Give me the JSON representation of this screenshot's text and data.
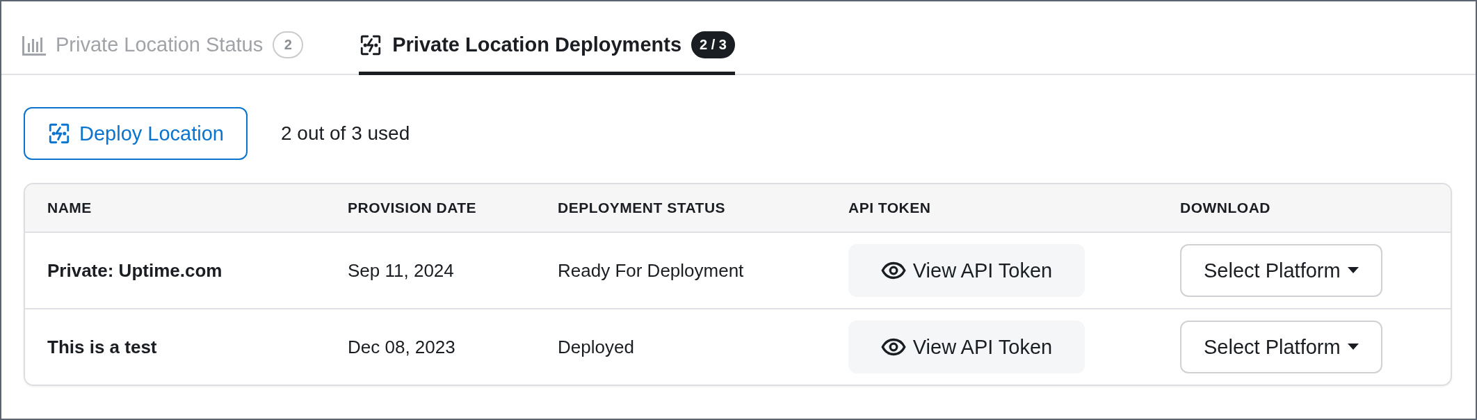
{
  "tabs": [
    {
      "label": "Private Location Status",
      "badge": "2",
      "kind": "chart",
      "selected": false
    },
    {
      "label": "Private Location Deployments",
      "badge": "2 / 3",
      "kind": "deploy",
      "selected": true
    }
  ],
  "deploy_button": {
    "label": "Deploy Location"
  },
  "usage": "2 out of 3 used",
  "table": {
    "columns": [
      "NAME",
      "PROVISION DATE",
      "DEPLOYMENT STATUS",
      "API TOKEN",
      "DOWNLOAD"
    ],
    "rows": [
      {
        "name": "Private: Uptime.com",
        "provision_date": "Sep 11, 2024",
        "deployment_status": "Ready For Deployment",
        "api_token": "View API Token",
        "download": "Select Platform"
      },
      {
        "name": "This is a test",
        "provision_date": "Dec 08, 2023",
        "deployment_status": "Deployed",
        "api_token": "View API Token",
        "download": "Select Platform"
      }
    ]
  }
}
